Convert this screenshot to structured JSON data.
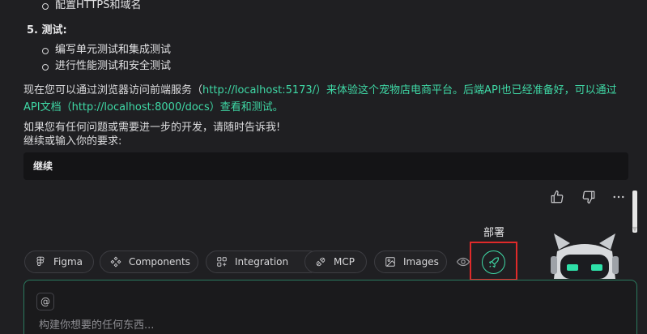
{
  "chat": {
    "deploy_items": [
      "配置HTTPS和域名"
    ],
    "step5_heading": "5. 测试:",
    "test_items": [
      "编写单元测试和集成测试",
      "进行性能测试和安全测试"
    ],
    "summary": {
      "prefix": "现在您可以通过浏览器访问前端服务（",
      "link1": "http://localhost:5173/",
      "mid": "）来体验这个宠物店电商平台。后端API也已经准备好，可以通过API文档（",
      "link2": "http://localhost:8000/docs",
      "suffix": "）查看和测试。"
    },
    "closing_line1": "如果您有任何问题或需要进一步的开发，请随时告诉我!",
    "closing_line2": "继续或输入你的要求:",
    "user_reply": "继续"
  },
  "feedback": {
    "like_icon": "thumbs-up-icon",
    "dislike_icon": "thumbs-down-icon",
    "more_icon": "more-icon"
  },
  "tooltip": {
    "deploy": "部署"
  },
  "chips": [
    {
      "label": "Figma",
      "icon": "figma-icon"
    },
    {
      "label": "Components",
      "icon": "components-icon"
    },
    {
      "label": "Integration",
      "icon": "integration-icon"
    },
    {
      "label": "MCP",
      "icon": "mcp-icon"
    },
    {
      "label": "Images",
      "icon": "image-icon"
    }
  ],
  "input": {
    "mention_symbol": "@",
    "placeholder": "构建你想要的任何东西..."
  },
  "colors": {
    "accent": "#3fd9a6",
    "highlight": "#e02a2a",
    "background": "#1f1f22"
  }
}
